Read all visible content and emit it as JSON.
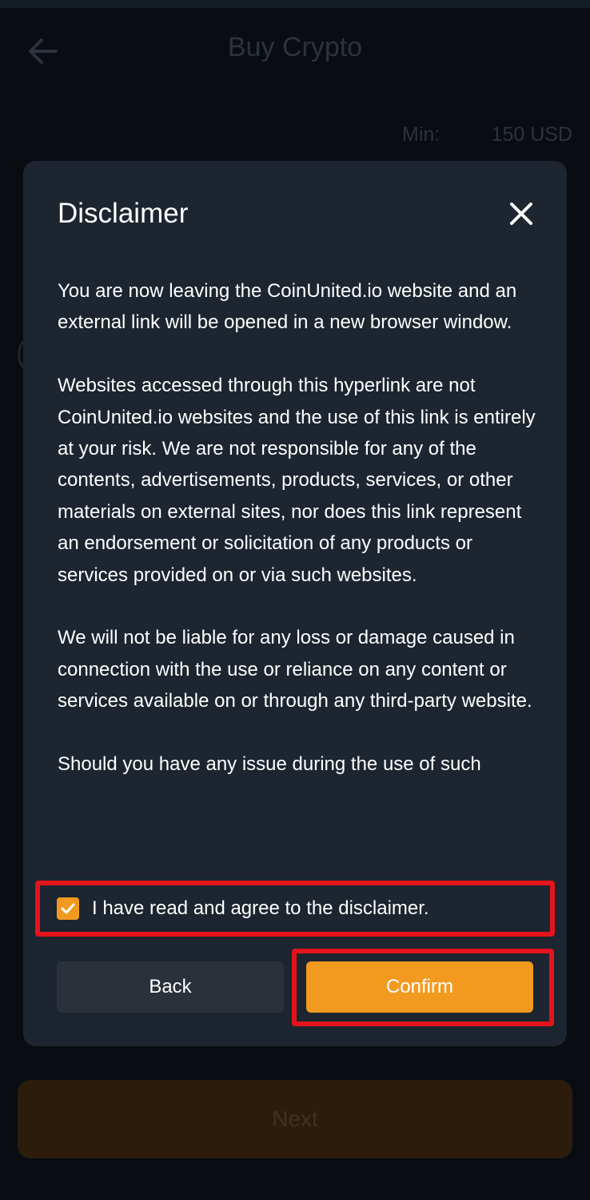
{
  "header": {
    "title": "Buy Crypto",
    "back_icon": "arrow-left-icon"
  },
  "limits": {
    "min_label": "Min:",
    "min_value": "150 USD"
  },
  "footer": {
    "next_label": "Next"
  },
  "modal": {
    "title": "Disclaimer",
    "close_icon": "close-icon",
    "paragraphs": [
      "You are now leaving the CoinUnited.io website and an external link will be opened in a new browser window.",
      "Websites accessed through this hyperlink are not CoinUnited.io websites and the use of this link is entirely at your risk. We are not responsible for any of the contents, advertisements, products, services, or other materials on external sites, nor does this link represent an endorsement or solicitation of any products or services provided on or via such websites.",
      "We will not be liable for any loss or damage caused in connection with the use or reliance on any content or services available on or through any third-party website.",
      "Should you have any issue during the use of such"
    ],
    "agree_label": "I have read and agree to the disclaimer.",
    "agree_checked": true,
    "back_label": "Back",
    "confirm_label": "Confirm"
  },
  "colors": {
    "accent": "#f29a1f",
    "highlight": "#e3141b",
    "modal_bg": "#1c2530",
    "page_bg": "#0d1218"
  }
}
